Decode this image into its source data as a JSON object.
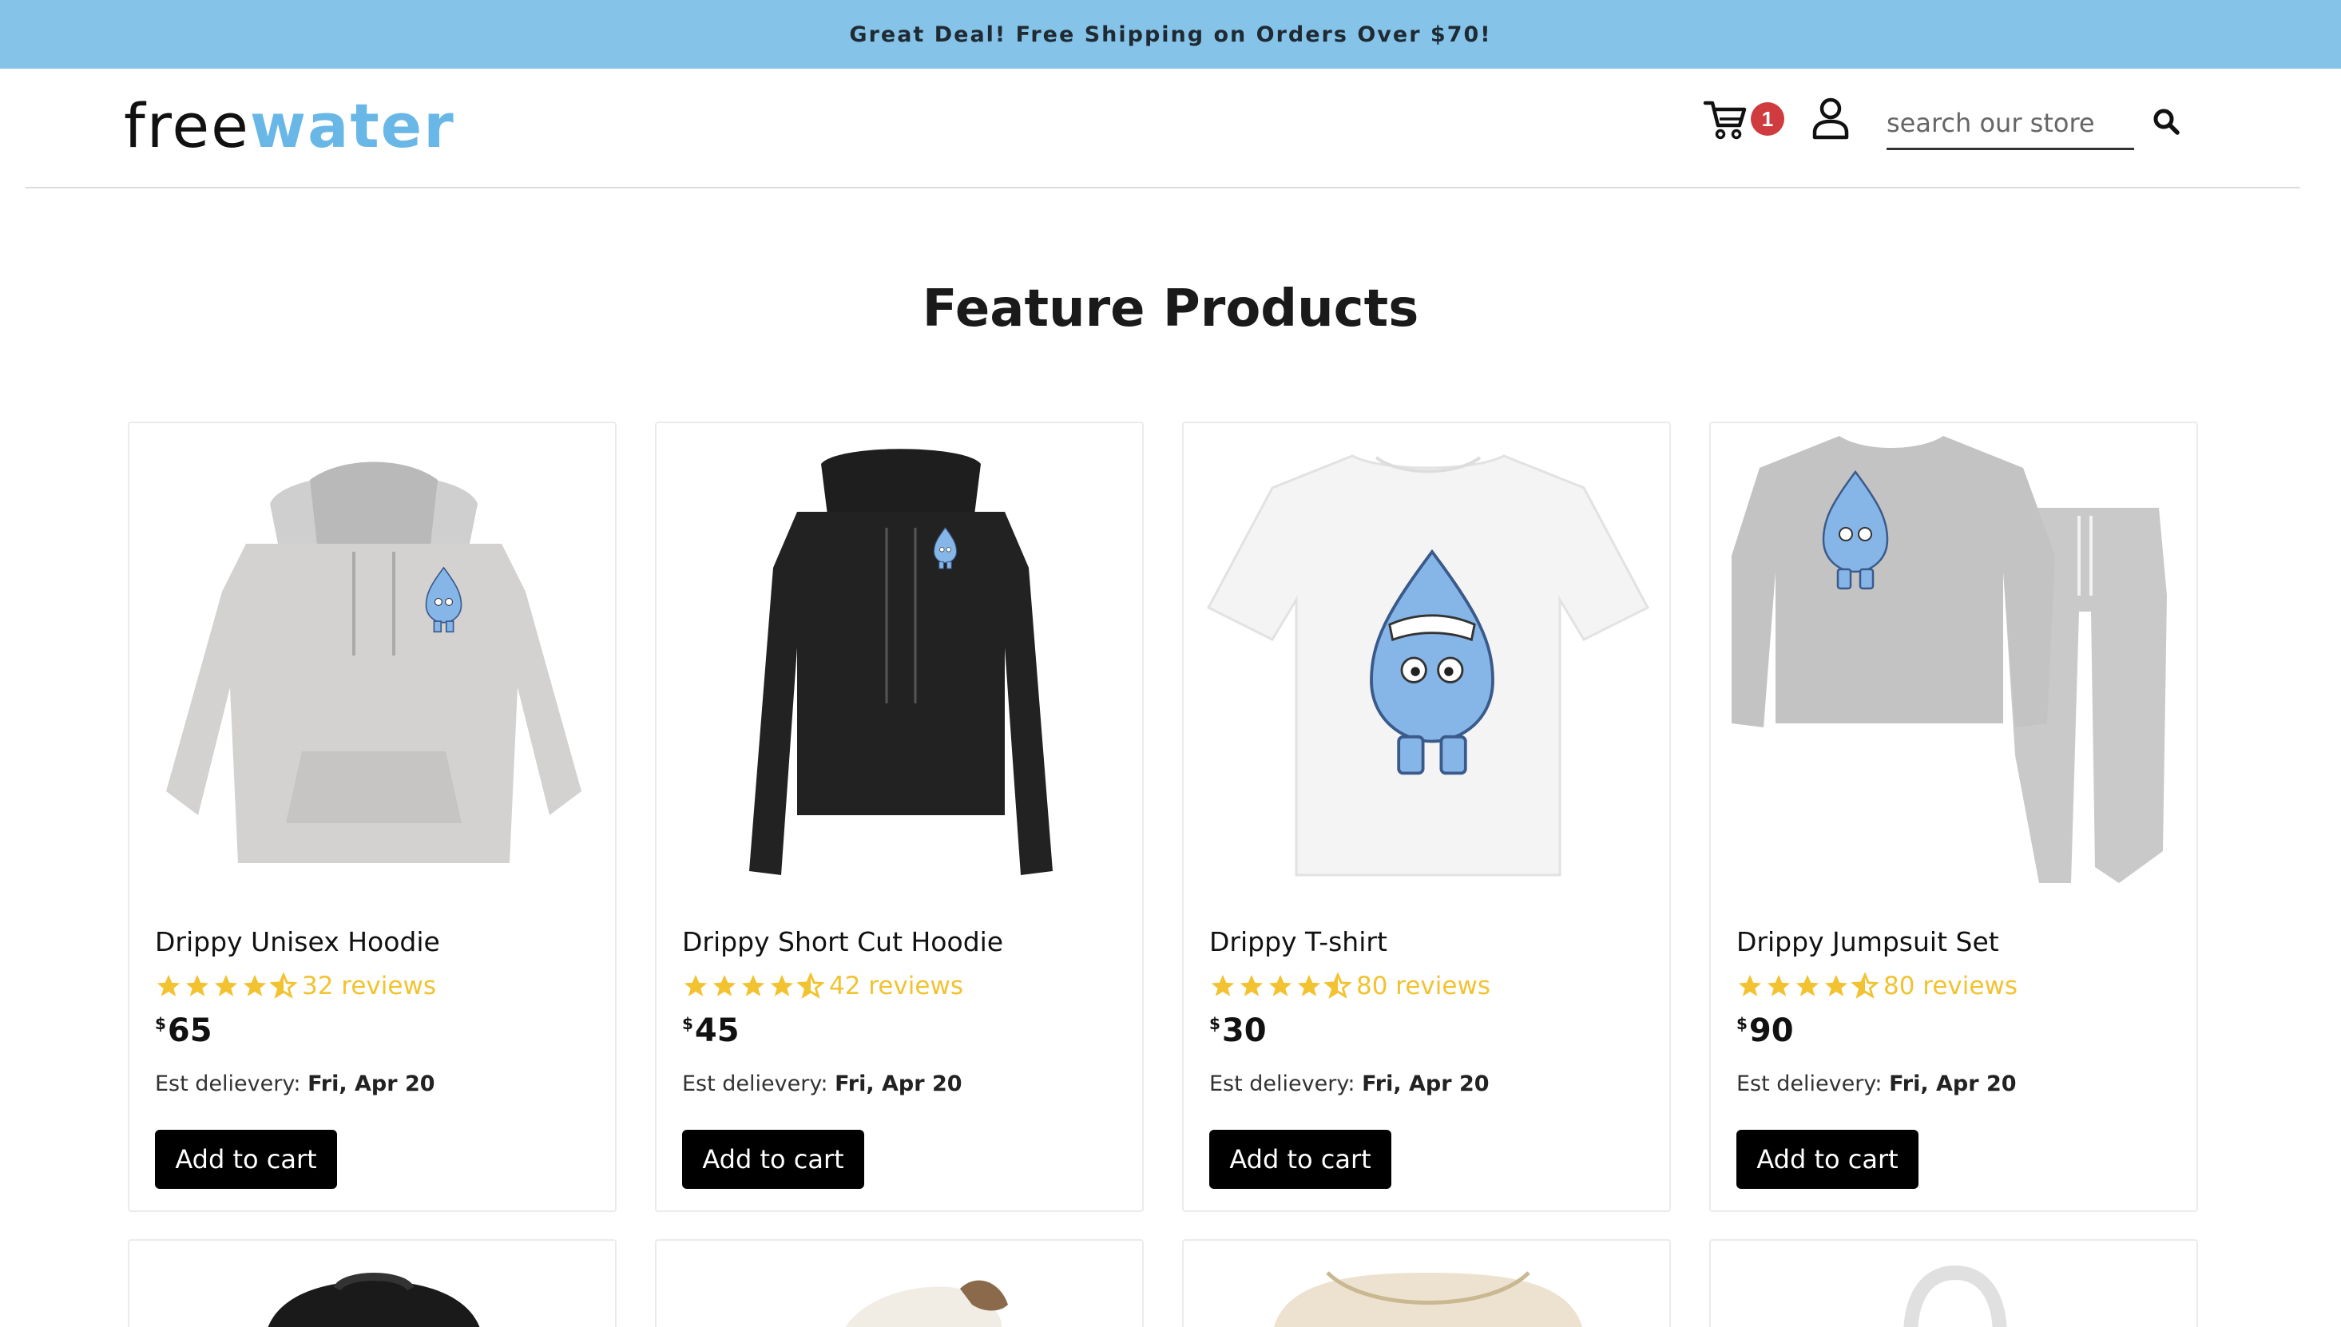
{
  "promo": {
    "text": "Great Deal! Free Shipping on Orders Over $70!"
  },
  "header": {
    "logo_part1": "free",
    "logo_part2": "water",
    "cart_count": "1",
    "search_placeholder": "search our store",
    "icons": [
      "cart-icon",
      "user-icon",
      "search-icon"
    ]
  },
  "section": {
    "title": "Feature Products"
  },
  "products": [
    {
      "name": "Drippy Unisex Hoodie",
      "rating": 4.5,
      "reviews": "32 reviews",
      "currency": "$",
      "price": "65",
      "delivery_label": "Est delievery:",
      "delivery_date": "Fri, Apr 20",
      "button": "Add to cart",
      "image": "grey-hoodie"
    },
    {
      "name": "Drippy Short Cut Hoodie",
      "rating": 4.5,
      "reviews": "42 reviews",
      "currency": "$",
      "price": "45",
      "delivery_label": "Est delievery:",
      "delivery_date": "Fri, Apr 20",
      "button": "Add to cart",
      "image": "black-cropped-hoodie"
    },
    {
      "name": "Drippy T-shirt",
      "rating": 4.5,
      "reviews": "80 reviews",
      "currency": "$",
      "price": "30",
      "delivery_label": "Est delievery:",
      "delivery_date": "Fri, Apr 20",
      "button": "Add to cart",
      "image": "white-tshirt"
    },
    {
      "name": "Drippy Jumpsuit Set",
      "rating": 4.5,
      "reviews": "80 reviews",
      "currency": "$",
      "price": "90",
      "delivery_label": "Est delievery:",
      "delivery_date": "Fri, Apr 20",
      "button": "Add to cart",
      "image": "grey-jumpsuit-set"
    }
  ],
  "colors": {
    "promo_bg": "#85c4e8",
    "brand_blue": "#69b7e6",
    "star": "#f2c230",
    "badge": "#cf3b3f",
    "button_bg": "#000000"
  }
}
